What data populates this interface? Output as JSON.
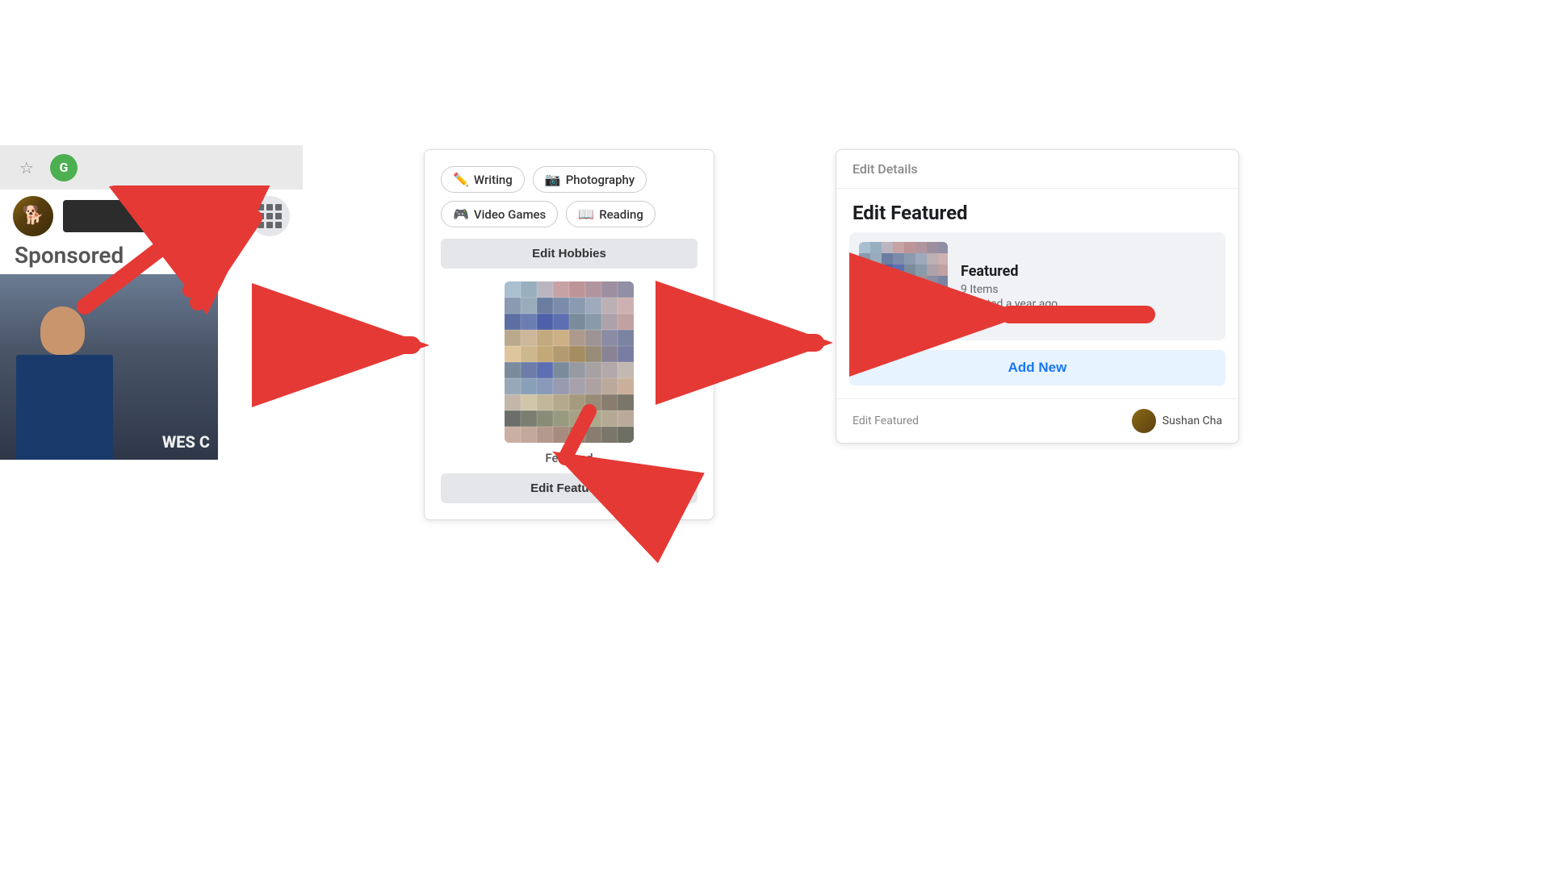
{
  "browser": {
    "star_icon": "☆",
    "green_circle_label": "G"
  },
  "profile": {
    "dots_label": "⠿",
    "wes_label": "WES C"
  },
  "sponsored": {
    "label": "Sponsored"
  },
  "center": {
    "hobbies": [
      {
        "icon": "✏️",
        "label": "Writing"
      },
      {
        "icon": "📷",
        "label": "Photography"
      },
      {
        "icon": "🎮",
        "label": "Video Games"
      },
      {
        "icon": "📖",
        "label": "Reading"
      }
    ],
    "edit_hobbies_label": "Edit Hobbies",
    "featured_label": "Featured",
    "edit_featured_label": "Edit Featured"
  },
  "right_panel": {
    "header_label": "Edit Details",
    "title": "Edit Featured",
    "featured_card": {
      "title": "Featured",
      "items": "9 Items",
      "updated": "Updated a year ago"
    },
    "add_new_label": "Add New",
    "footer_edit_label": "Edit Featured",
    "footer_user": "Sushan Cha"
  },
  "arrows": {
    "color": "#e53935"
  }
}
